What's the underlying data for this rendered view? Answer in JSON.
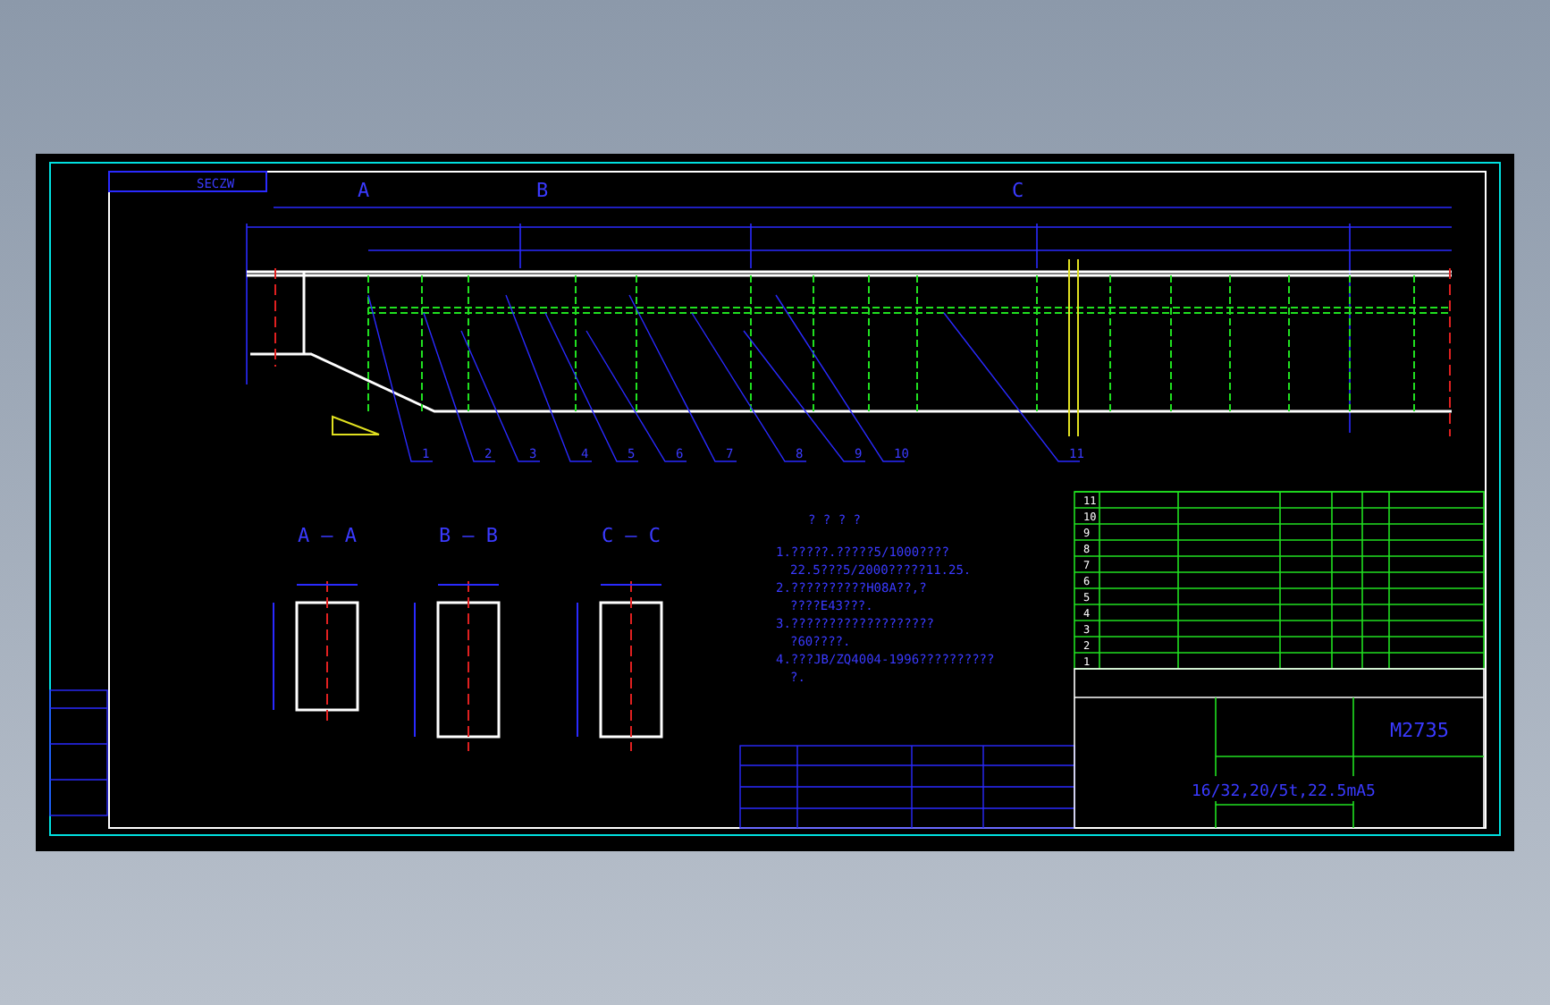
{
  "drawing_tag": "SECZW",
  "section_markers": [
    "A",
    "B",
    "C"
  ],
  "part_balloons": [
    "1",
    "2",
    "3",
    "4",
    "5",
    "6",
    "7",
    "8",
    "9",
    "10",
    "11"
  ],
  "sections": [
    {
      "title": "A — A"
    },
    {
      "title": "B — B"
    },
    {
      "title": "C — C"
    }
  ],
  "notes": {
    "title": "?   ?   ?   ?",
    "lines": [
      "1.?????.?????5/1000????",
      "22.5???5/2000?????11.25.",
      "2.??????????H08A??,?",
      "????E43???.",
      "3.???????????????????",
      "?60????.",
      "4.???JB/ZQ4004-1996??????????",
      "?."
    ]
  },
  "parts_list": {
    "rows": [
      "11",
      "10",
      "9",
      "8",
      "7",
      "6",
      "5",
      "4",
      "3",
      "2",
      "1"
    ]
  },
  "title_block": {
    "drawing_number": "M2735",
    "specification": "16/32,20/5t,22.5mA5"
  }
}
